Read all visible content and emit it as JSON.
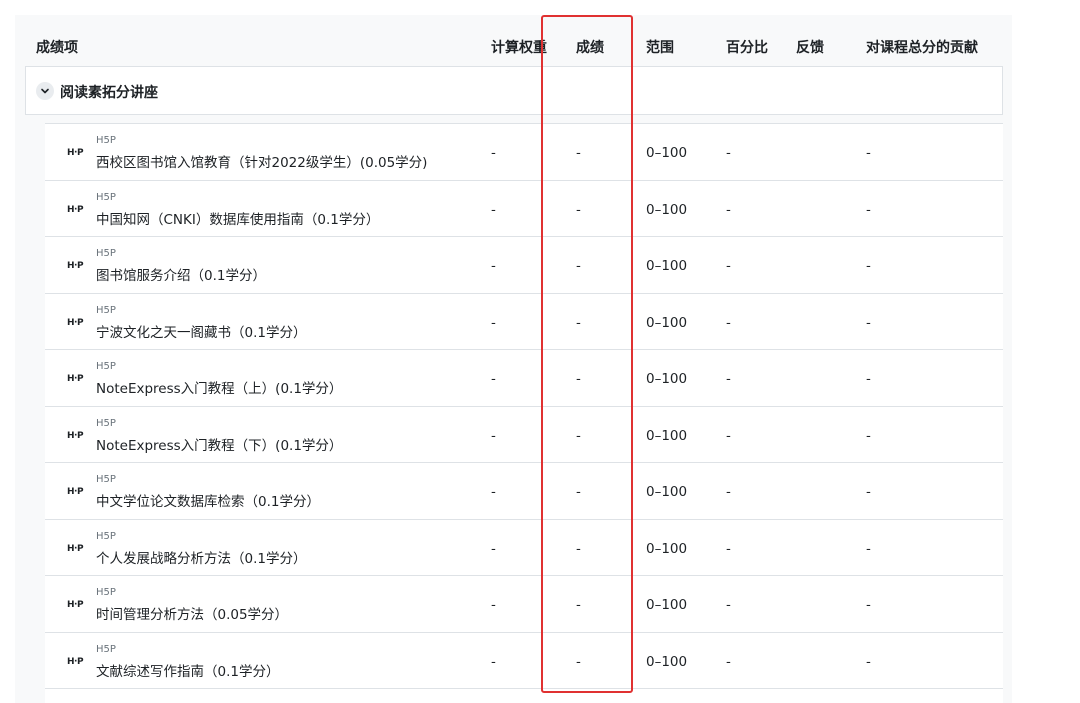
{
  "headers": {
    "grade_item": "成绩项",
    "weight": "计算权重",
    "grade": "成绩",
    "range": "范围",
    "percentage": "百分比",
    "feedback": "反馈",
    "contribution": "对课程总分的贡献"
  },
  "category": {
    "name": "阅读素拓分讲座",
    "toggle_icon": "chevron-down-icon"
  },
  "items": [
    {
      "type": "H5P",
      "name": "西校区图书馆入馆教育（针对2022级学生）(0.05学分)",
      "weight": "-",
      "grade": "-",
      "range": "0–100",
      "percentage": "-",
      "contribution": "-"
    },
    {
      "type": "H5P",
      "name": "中国知网（CNKI）数据库使用指南（0.1学分）",
      "weight": "-",
      "grade": "-",
      "range": "0–100",
      "percentage": "-",
      "contribution": "-"
    },
    {
      "type": "H5P",
      "name": "图书馆服务介绍（0.1学分）",
      "weight": "-",
      "grade": "-",
      "range": "0–100",
      "percentage": "-",
      "contribution": "-"
    },
    {
      "type": "H5P",
      "name": "宁波文化之天一阁藏书（0.1学分）",
      "weight": "-",
      "grade": "-",
      "range": "0–100",
      "percentage": "-",
      "contribution": "-"
    },
    {
      "type": "H5P",
      "name": "NoteExpress入门教程（上）(0.1学分）",
      "weight": "-",
      "grade": "-",
      "range": "0–100",
      "percentage": "-",
      "contribution": "-"
    },
    {
      "type": "H5P",
      "name": "NoteExpress入门教程（下）(0.1学分）",
      "weight": "-",
      "grade": "-",
      "range": "0–100",
      "percentage": "-",
      "contribution": "-"
    },
    {
      "type": "H5P",
      "name": "中文学位论文数据库检索（0.1学分）",
      "weight": "-",
      "grade": "-",
      "range": "0–100",
      "percentage": "-",
      "contribution": "-"
    },
    {
      "type": "H5P",
      "name": "个人发展战略分析方法（0.1学分）",
      "weight": "-",
      "grade": "-",
      "range": "0–100",
      "percentage": "-",
      "contribution": "-"
    },
    {
      "type": "H5P",
      "name": "时间管理分析方法（0.05学分）",
      "weight": "-",
      "grade": "-",
      "range": "0–100",
      "percentage": "-",
      "contribution": "-"
    },
    {
      "type": "H5P",
      "name": "文献综述写作指南（0.1学分）",
      "weight": "-",
      "grade": "-",
      "range": "0–100",
      "percentage": "-",
      "contribution": "-"
    }
  ],
  "icons": {
    "h5p_logo": "H·P",
    "highlight_color": "#e03131"
  }
}
